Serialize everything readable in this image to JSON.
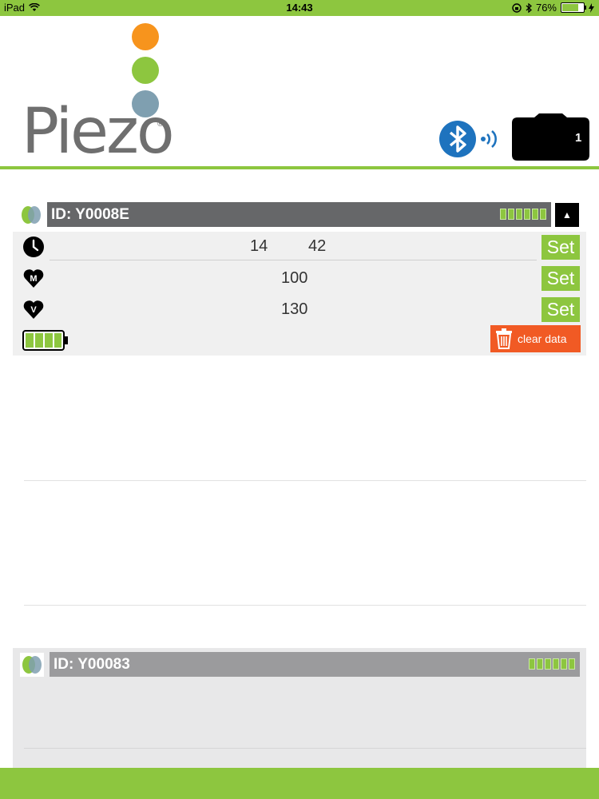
{
  "status_bar": {
    "device": "iPad",
    "time": "14:43",
    "battery_percent": "76%",
    "battery_level": 0.76,
    "icons": [
      "wifi-icon",
      "orientation-lock-icon",
      "bluetooth-icon",
      "charging-icon"
    ]
  },
  "header": {
    "logo_text": "Piezo",
    "logo_registered": "®",
    "logo_dot_colors": [
      "#f7941d",
      "#8dc63f",
      "#7f9fb0"
    ],
    "connected_devices_count": "1"
  },
  "devices": [
    {
      "id_label": "ID: Y0008E",
      "signal_segments": 6,
      "expanded": true,
      "time_hour": "14",
      "time_minute": "42",
      "m_value": "100",
      "v_value": "130",
      "set_label": "Set",
      "clear_label": "clear data",
      "battery_segments": 4
    },
    {
      "id_label": "ID: Y00083",
      "signal_segments": 6,
      "expanded": false
    }
  ],
  "colors": {
    "accent_green": "#8dc63f",
    "clear_orange": "#f15a24",
    "id_bar_dark": "#666769",
    "id_bar_light": "#9b9b9d",
    "bluetooth_blue": "#1e73be"
  }
}
